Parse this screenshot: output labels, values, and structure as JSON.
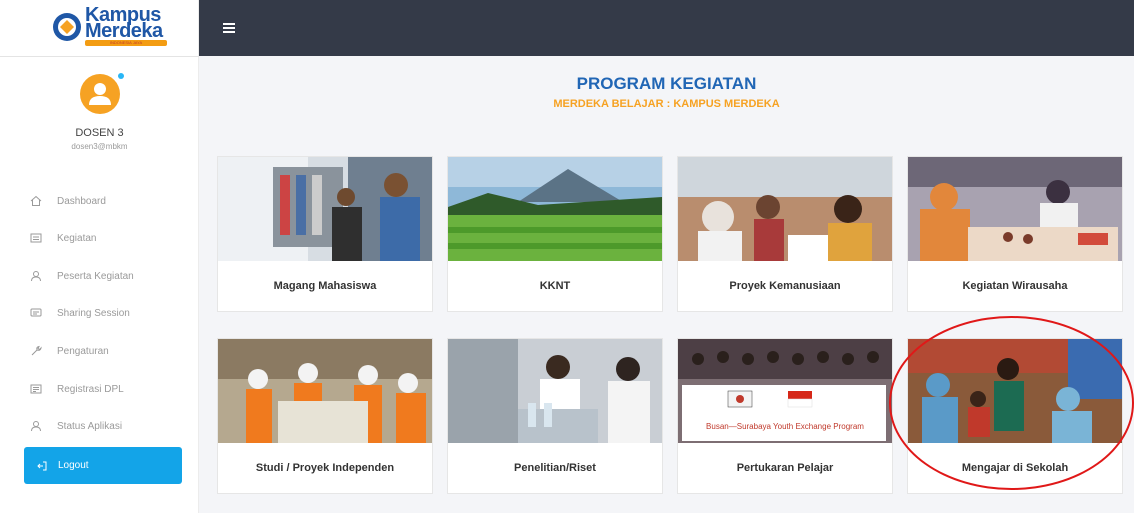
{
  "brand": {
    "line1": "Kampus",
    "line2": "Merdeka",
    "tagline": "INDONESIA JAYA"
  },
  "user": {
    "name": "DOSEN 3",
    "email": "dosen3@mbkm"
  },
  "sidebar": {
    "items": [
      {
        "label": "Dashboard",
        "icon": "home-icon"
      },
      {
        "label": "Kegiatan",
        "icon": "list-icon"
      },
      {
        "label": "Peserta Kegiatan",
        "icon": "user-icon"
      },
      {
        "label": "Sharing Session",
        "icon": "chat-icon"
      },
      {
        "label": "Pengaturan",
        "icon": "wrench-icon"
      },
      {
        "label": "Registrasi DPL",
        "icon": "form-icon"
      },
      {
        "label": "Status Aplikasi",
        "icon": "user-icon"
      }
    ],
    "logout": "Logout"
  },
  "header": {
    "title": "PROGRAM KEGIATAN",
    "subtitle": "MERDEKA BELAJAR : KAMPUS MERDEKA"
  },
  "programs": [
    {
      "label": "Magang Mahasiswa"
    },
    {
      "label": "KKNT"
    },
    {
      "label": "Proyek Kemanusiaan"
    },
    {
      "label": "Kegiatan Wirausaha"
    },
    {
      "label": "Studi / Proyek Independen"
    },
    {
      "label": "Penelitian/Riset"
    },
    {
      "label": "Pertukaran Pelajar",
      "banner": "Busan—Surabaya Youth Exchange Program"
    },
    {
      "label": "Mengajar di Sekolah",
      "highlighted": true
    }
  ],
  "colors": {
    "sidebar_active": "#13a4e8",
    "topbar": "#343a48",
    "title": "#2166b5",
    "subtitle": "#f6a223",
    "highlight": "#e01818"
  }
}
